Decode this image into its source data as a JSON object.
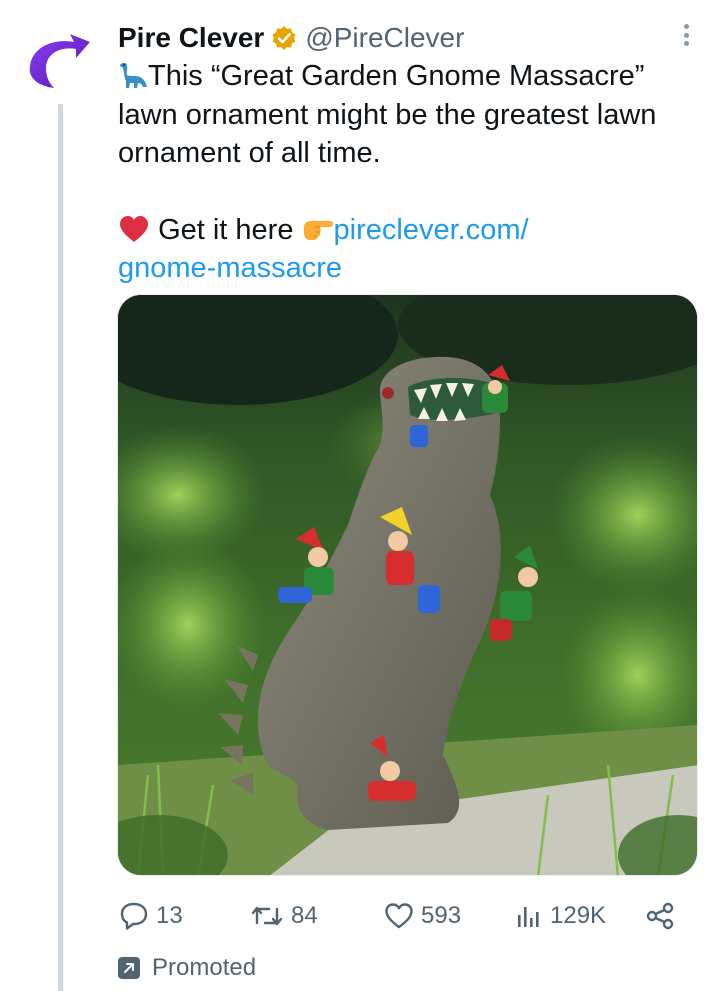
{
  "author": {
    "name": "Pire Clever",
    "handle": "@PireClever"
  },
  "tweet": {
    "line1": "This “Great Garden Gnome Massacre”",
    "line2": "lawn ornament might be the greatest lawn",
    "line3": "ornament of all time.",
    "cta_text": "Get it here",
    "link_part1": "pireclever.com/",
    "link_part2": "gnome-massacre"
  },
  "icons": {
    "dinosaur": "dinosaur-emoji",
    "heart": "red-heart-emoji",
    "pointing": "pointing-right-emoji",
    "verified": "gold-verified-badge"
  },
  "image": {
    "description_label": "T-rex garden gnome statue"
  },
  "actions": {
    "replies": "13",
    "reposts": "84",
    "likes": "593",
    "views": "129K"
  },
  "promoted_label": "Promoted",
  "colors": {
    "link": "#1d9bf0",
    "secondary_text": "#536471",
    "brand_purple": "#7b2cd8",
    "verified_gold": "#e8a500"
  }
}
